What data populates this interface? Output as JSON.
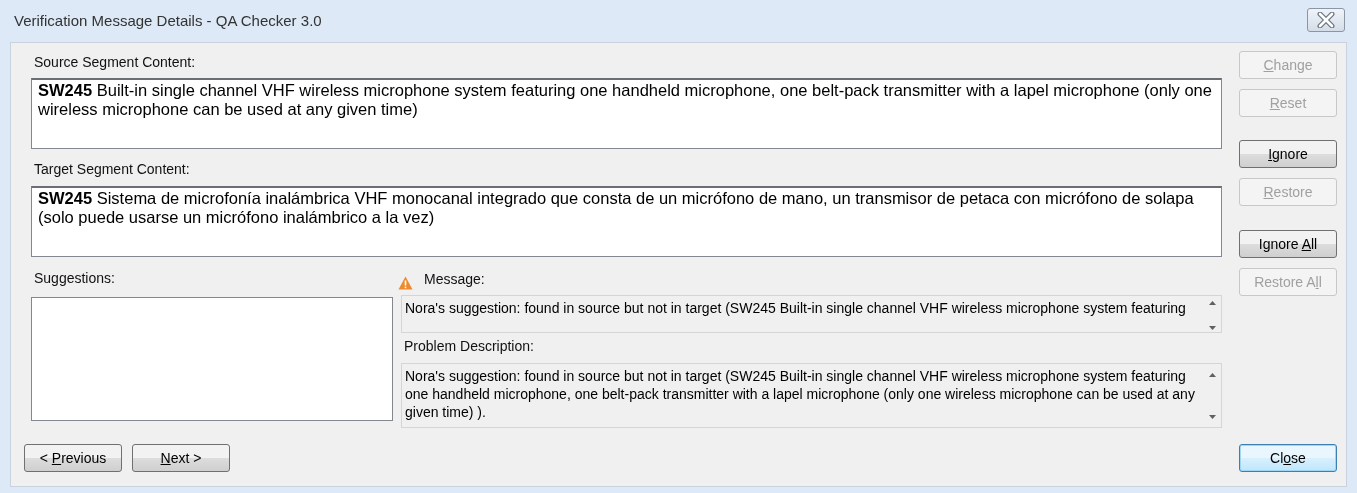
{
  "window": {
    "title": "Verification Message Details - QA Checker 3.0"
  },
  "source": {
    "label": "Source Segment Content:",
    "text": "**SW245** Built-in single channel VHF wireless microphone system featuring one handheld microphone, one belt-pack transmitter with a lapel microphone (only one wireless microphone can be used at any given time)"
  },
  "target": {
    "label": "Target Segment Content:",
    "text": "**SW245** Sistema de microfonía inalámbrica VHF monocanal integrado que consta de un micrófono de mano, un transmisor de petaca con micrófono de solapa (solo puede usarse un micrófono inalámbrico a la vez)"
  },
  "suggestions": {
    "label": "Suggestions:"
  },
  "message": {
    "label": "Message:",
    "kind": "warning",
    "text": "Nora's suggestion: found in source but not in target (SW245 Built-in single channel VHF wireless microphone system featuring"
  },
  "problem": {
    "label": "Problem Description:",
    "text": "Nora's suggestion: found in source but not in target (SW245 Built-in single channel VHF wireless microphone system featuring one handheld microphone, one belt-pack transmitter with a lapel microphone (only one wireless microphone can be used at any given time) )."
  },
  "side_button_groups": [
    {
      "buttons": [
        {
          "label": [
            {
              "text": "C",
              "underline": true
            },
            {
              "text": "hange",
              "underline": false
            }
          ],
          "disabled": true
        },
        {
          "label": [
            {
              "text": "R",
              "underline": true
            },
            {
              "text": "eset",
              "underline": false
            }
          ],
          "disabled": true
        }
      ]
    },
    {
      "buttons": [
        {
          "label": [
            {
              "text": "I",
              "underline": true
            },
            {
              "text": "gnore",
              "underline": false
            }
          ],
          "disabled": false
        },
        {
          "label": [
            {
              "text": "R",
              "underline": true
            },
            {
              "text": "estore",
              "underline": false
            }
          ],
          "disabled": true
        }
      ]
    },
    {
      "buttons": [
        {
          "label": [
            {
              "text": "Ignore ",
              "underline": false
            },
            {
              "text": "A",
              "underline": true
            },
            {
              "text": "ll",
              "underline": false
            }
          ],
          "disabled": false
        },
        {
          "label": [
            {
              "text": "Restore A",
              "underline": false
            },
            {
              "text": "l",
              "underline": true
            },
            {
              "text": "l",
              "underline": false
            }
          ],
          "disabled": true
        }
      ]
    }
  ],
  "nav_buttons": [
    {
      "label": [
        {
          "text": "< ",
          "underline": false
        },
        {
          "text": "P",
          "underline": true
        },
        {
          "text": "revious",
          "underline": false
        }
      ]
    },
    {
      "label": [
        {
          "text": "N",
          "underline": true
        },
        {
          "text": "ext >",
          "underline": false
        }
      ]
    }
  ],
  "close_button": {
    "label": [
      {
        "text": "Cl",
        "underline": false
      },
      {
        "text": "o",
        "underline": true
      },
      {
        "text": "se",
        "underline": false
      }
    ],
    "default": true
  }
}
